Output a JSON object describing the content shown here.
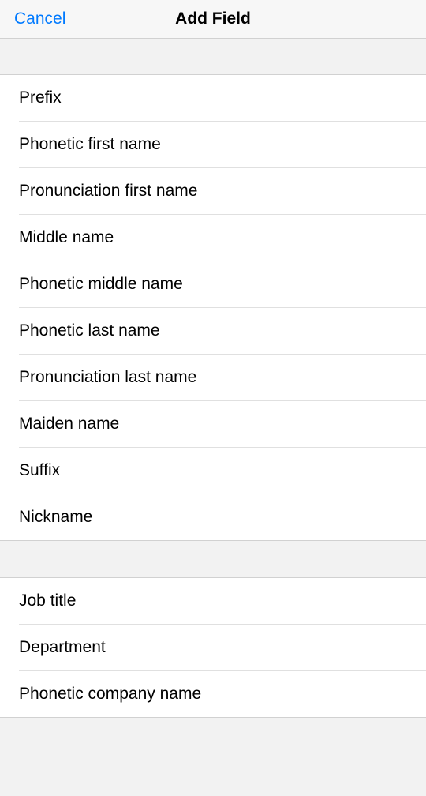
{
  "header": {
    "cancel": "Cancel",
    "title": "Add Field"
  },
  "section1": [
    {
      "label": "Prefix"
    },
    {
      "label": "Phonetic first name"
    },
    {
      "label": "Pronunciation first name"
    },
    {
      "label": "Middle name"
    },
    {
      "label": "Phonetic middle name"
    },
    {
      "label": "Phonetic last name"
    },
    {
      "label": "Pronunciation last name"
    },
    {
      "label": "Maiden name"
    },
    {
      "label": "Suffix"
    },
    {
      "label": "Nickname"
    }
  ],
  "section2": [
    {
      "label": "Job title"
    },
    {
      "label": "Department"
    },
    {
      "label": "Phonetic company name"
    }
  ]
}
